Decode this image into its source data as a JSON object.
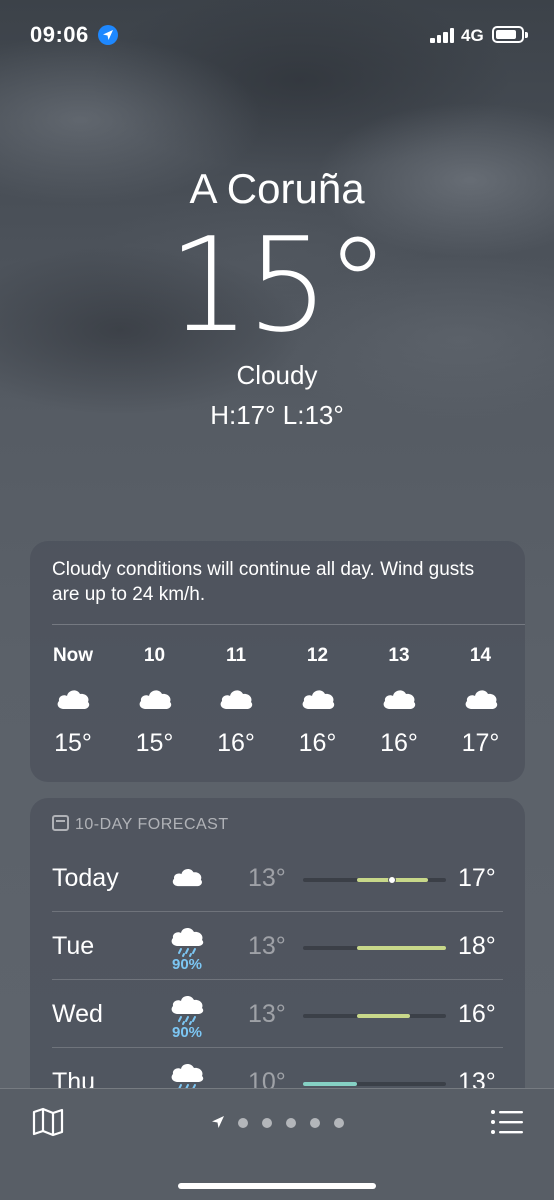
{
  "status_bar": {
    "time": "09:06",
    "network": "4G"
  },
  "location": {
    "city": "A Coruña",
    "current_temp": "15°",
    "condition": "Cloudy",
    "hi_lo": "H:17°  L:13°"
  },
  "hourly": {
    "summary": "Cloudy conditions will continue all day. Wind gusts are up to 24 km/h.",
    "hours": [
      {
        "label": "Now",
        "icon": "cloud-icon",
        "temp": "15°"
      },
      {
        "label": "10",
        "icon": "cloud-icon",
        "temp": "15°"
      },
      {
        "label": "11",
        "icon": "cloud-icon",
        "temp": "16°"
      },
      {
        "label": "12",
        "icon": "cloud-icon",
        "temp": "16°"
      },
      {
        "label": "13",
        "icon": "cloud-icon",
        "temp": "16°"
      },
      {
        "label": "14",
        "icon": "cloud-icon",
        "temp": "17°"
      }
    ]
  },
  "forecast": {
    "header": "10-DAY FORECAST",
    "range_min": 10,
    "range_max": 18,
    "days": [
      {
        "day": "Today",
        "icon": "cloud-icon",
        "precip": "",
        "low": "13°",
        "high": "17°",
        "low_val": 13,
        "high_val": 17,
        "current_val": 15,
        "bar_color": "#c8d88a"
      },
      {
        "day": "Tue",
        "icon": "cloud-rain-icon",
        "precip": "90%",
        "low": "13°",
        "high": "18°",
        "low_val": 13,
        "high_val": 18,
        "bar_color": "#c8d88a"
      },
      {
        "day": "Wed",
        "icon": "cloud-rain-icon",
        "precip": "90%",
        "low": "13°",
        "high": "16°",
        "low_val": 13,
        "high_val": 16,
        "bar_color": "#c8d88a"
      },
      {
        "day": "Thu",
        "icon": "cloud-rain-icon",
        "precip": "",
        "low": "10°",
        "high": "13°",
        "low_val": 10,
        "high_val": 13,
        "bar_color": "#86d1c4"
      }
    ]
  },
  "bottom_bar": {
    "left_icon": "map-icon",
    "right_icon": "list-icon",
    "page_count": 5
  }
}
